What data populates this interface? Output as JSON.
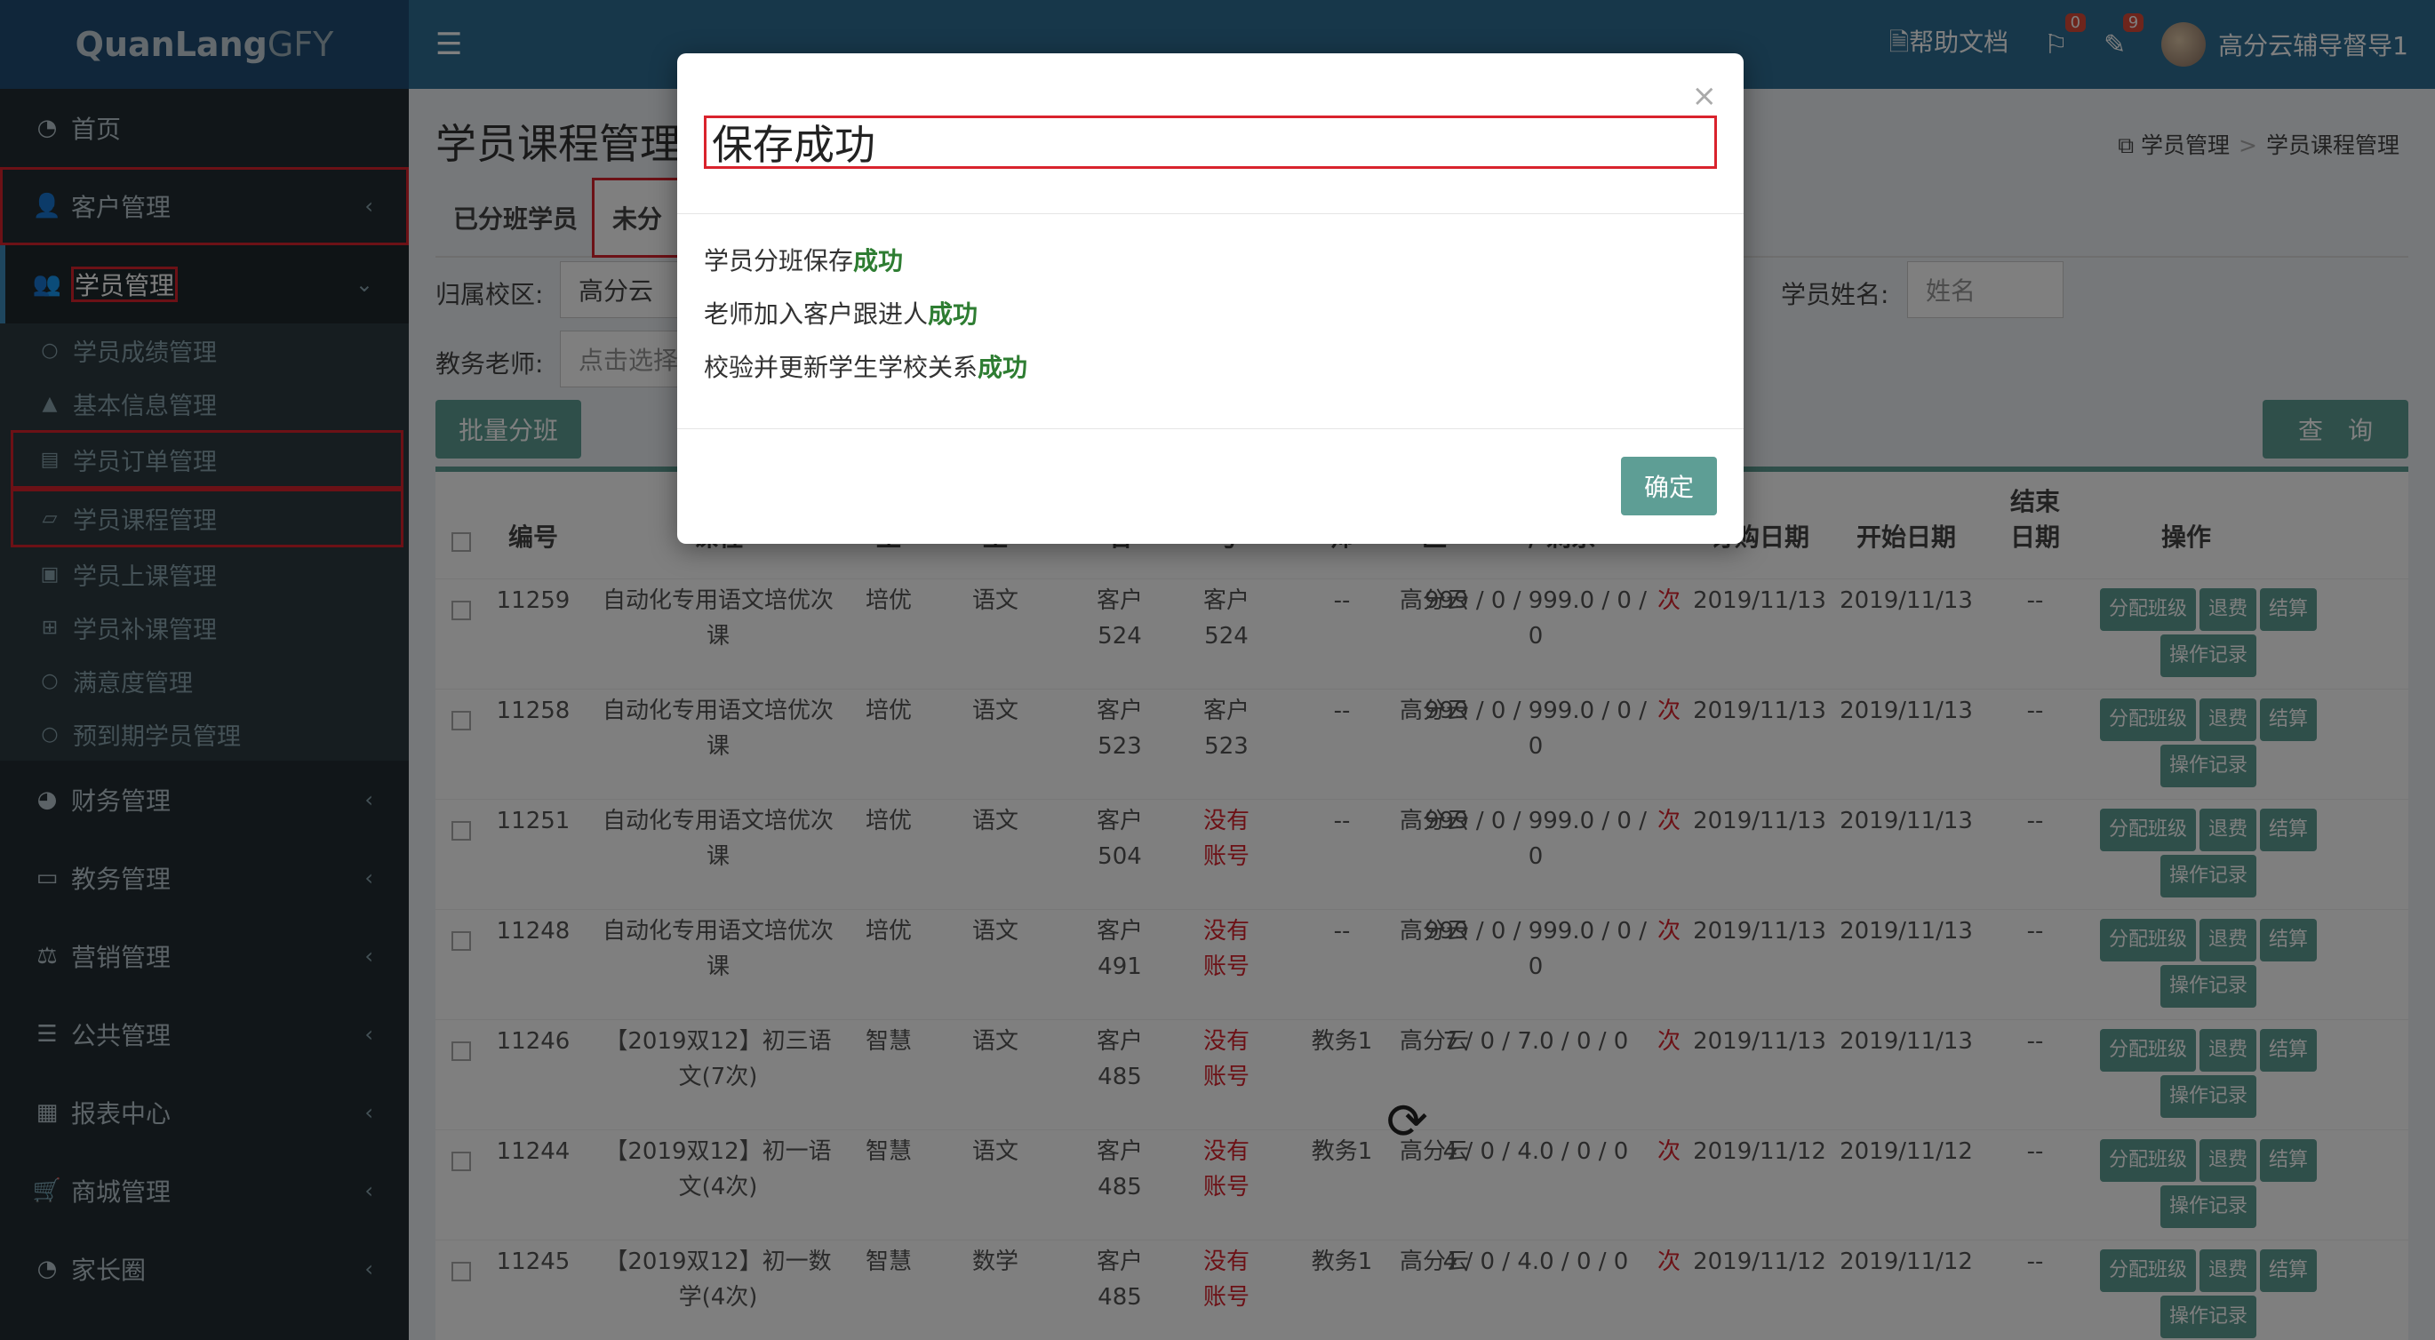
{
  "logo": {
    "bold": "QuanLang",
    "light": "GFY"
  },
  "header": {
    "help": "帮助文档",
    "flag_badge": "0",
    "edit_badge": "9",
    "user": "高分云辅导督导1"
  },
  "sidebar": {
    "home": "首页",
    "customer": "客户管理",
    "student": "学员管理",
    "sub": {
      "scores": "学员成绩管理",
      "basic": "基本信息管理",
      "orders": "学员订单管理",
      "courses": "学员课程管理",
      "attend": "学员上课管理",
      "makeup": "学员补课管理",
      "satisfaction": "满意度管理",
      "expiring": "预到期学员管理"
    },
    "finance": "财务管理",
    "academic": "教务管理",
    "marketing": "营销管理",
    "public": "公共管理",
    "reports": "报表中心",
    "mall": "商城管理",
    "parents": "家长圈"
  },
  "page": {
    "title": "学员课程管理",
    "breadcrumb": [
      "学员管理",
      "学员课程管理"
    ]
  },
  "tabs": [
    "已分班学员",
    "未分"
  ],
  "filters": {
    "campus_label": "归属校区:",
    "campus_value": "高分云",
    "teacher_label": "教务老师:",
    "teacher_placeholder": "点击选择",
    "name_label": "学员姓名:",
    "name_placeholder": "姓名"
  },
  "buttons": {
    "batch": "批量分班",
    "search": "查　询"
  },
  "table": {
    "headers": [
      "编号",
      "课程",
      "型",
      "型",
      "名",
      "号",
      "师",
      "区",
      "/ 剩余",
      "订购日期",
      "开始日期",
      "结束日期",
      "操作"
    ],
    "actions": [
      "分配班级",
      "退费",
      "结算",
      "操作记录"
    ],
    "rows": [
      {
        "id": "11259",
        "course": "自动化专用语文培优次课",
        "type": "培优",
        "subject": "语文",
        "name": "客户524",
        "account": "客户524",
        "teacher": "--",
        "campus": "高分云",
        "hours": "999 / 0 / 999.0 / 0 / 0",
        "unit": "次",
        "order_date": "2019/11/13",
        "start_date": "2019/11/13",
        "end_date": "--"
      },
      {
        "id": "11258",
        "course": "自动化专用语文培优次课",
        "type": "培优",
        "subject": "语文",
        "name": "客户523",
        "account": "客户523",
        "teacher": "--",
        "campus": "高分云",
        "hours": "999 / 0 / 999.0 / 0 / 0",
        "unit": "次",
        "order_date": "2019/11/13",
        "start_date": "2019/11/13",
        "end_date": "--"
      },
      {
        "id": "11251",
        "course": "自动化专用语文培优次课",
        "type": "培优",
        "subject": "语文",
        "name": "客户504",
        "account": "没有账号",
        "teacher": "--",
        "campus": "高分云",
        "hours": "999 / 0 / 999.0 / 0 / 0",
        "unit": "次",
        "order_date": "2019/11/13",
        "start_date": "2019/11/13",
        "end_date": "--"
      },
      {
        "id": "11248",
        "course": "自动化专用语文培优次课",
        "type": "培优",
        "subject": "语文",
        "name": "客户491",
        "account": "没有账号",
        "teacher": "--",
        "campus": "高分云",
        "hours": "999 / 0 / 999.0 / 0 / 0",
        "unit": "次",
        "order_date": "2019/11/13",
        "start_date": "2019/11/13",
        "end_date": "--"
      },
      {
        "id": "11246",
        "course": "【2019双12】初三语文(7次)",
        "type": "智慧",
        "subject": "语文",
        "name": "客户485",
        "account": "没有账号",
        "teacher": "教务1",
        "campus": "高分云",
        "hours": "7 / 0 / 7.0 / 0 / 0",
        "unit": "次",
        "order_date": "2019/11/13",
        "start_date": "2019/11/13",
        "end_date": "--"
      },
      {
        "id": "11244",
        "course": "【2019双12】初一语文(4次)",
        "type": "智慧",
        "subject": "语文",
        "name": "客户485",
        "account": "没有账号",
        "teacher": "教务1",
        "campus": "高分云",
        "hours": "4 / 0 / 4.0 / 0 / 0",
        "unit": "次",
        "order_date": "2019/11/12",
        "start_date": "2019/11/12",
        "end_date": "--"
      },
      {
        "id": "11245",
        "course": "【2019双12】初一数学(4次)",
        "type": "智慧",
        "subject": "数学",
        "name": "客户485",
        "account": "没有账号",
        "teacher": "教务1",
        "campus": "高分云",
        "hours": "4 / 0 / 4.0 / 0 / 0",
        "unit": "次",
        "order_date": "2019/11/12",
        "start_date": "2019/11/12",
        "end_date": "--"
      }
    ]
  },
  "modal": {
    "title": "保存成功",
    "close": "×",
    "messages": [
      {
        "text": "学员分班保存",
        "status": "成功"
      },
      {
        "text": "老师加入客户跟进人",
        "status": "成功"
      },
      {
        "text": "校验并更新学生学校关系",
        "status": "成功"
      }
    ],
    "confirm": "确定"
  },
  "colors": {
    "accent": "#5e9e95",
    "highlight": "#d9232d",
    "success": "#2e7d32",
    "sidebar": "#222d32",
    "header": "#2f6f94"
  }
}
